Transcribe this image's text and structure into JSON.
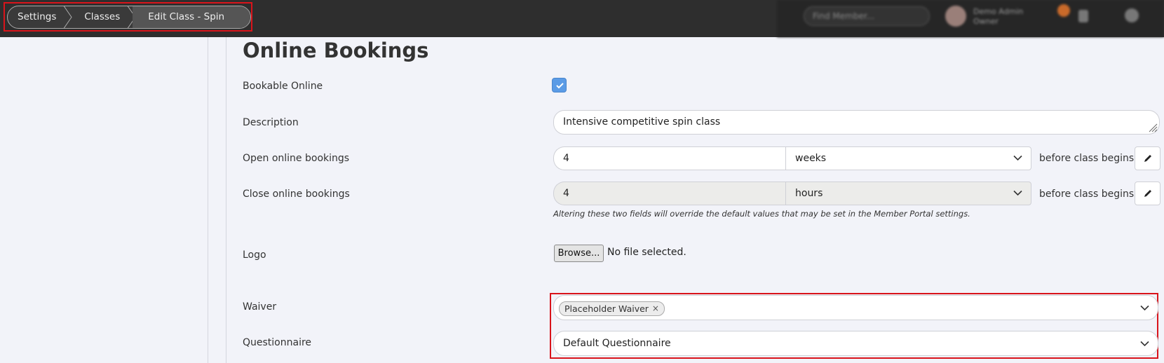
{
  "breadcrumb": {
    "items": [
      "Settings",
      "Classes",
      "Edit Class - Spin Class"
    ]
  },
  "top_right": {
    "search_placeholder": "Find Member...",
    "user_name": "Demo Admin",
    "user_role": "Owner"
  },
  "section": {
    "title": "Online Bookings"
  },
  "form": {
    "bookable_online": {
      "label": "Bookable Online",
      "checked": true
    },
    "description": {
      "label": "Description",
      "value": "Intensive competitive spin class"
    },
    "open_bookings": {
      "label": "Open online bookings",
      "value": "4",
      "unit": "weeks",
      "suffix": "before class begins"
    },
    "close_bookings": {
      "label": "Close online bookings",
      "value": "4",
      "unit": "hours",
      "suffix": "before class begins"
    },
    "help_text": "Altering these two fields will override the default values that may be set in the Member Portal settings.",
    "logo": {
      "label": "Logo",
      "browse_label": "Browse...",
      "file_status": "No file selected."
    },
    "waiver": {
      "label": "Waiver",
      "selected_tag": "Placeholder Waiver",
      "remove_glyph": "×"
    },
    "questionnaire": {
      "label": "Questionnaire",
      "value": "Default Questionnaire"
    }
  },
  "colors": {
    "topbar": "#2e2e2e",
    "accent_checkbox": "#5b9be6",
    "highlight": "#d9141b",
    "page_bg": "#f2f3f9"
  }
}
